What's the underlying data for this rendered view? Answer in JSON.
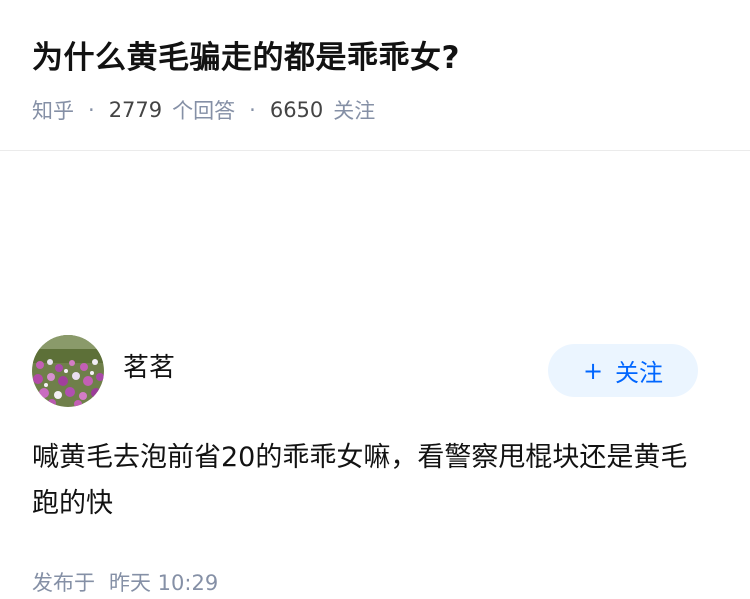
{
  "question": {
    "title": "为什么黄毛骗走的都是乖乖女?",
    "meta": {
      "source": "知乎",
      "answers_count": "2779",
      "answers_label": "个回答",
      "followers_count": "6650",
      "followers_label": "关注"
    }
  },
  "answer": {
    "author": "茗茗",
    "follow_button": {
      "icon": "+",
      "label": "关注"
    },
    "content": "喊黄毛去泡前省20的乖乖女嘛，看警察甩棍块还是黄毛跑的快",
    "published_label": "发布于",
    "published_time": "昨天 10:29"
  },
  "colors": {
    "accent": "#0066ff",
    "follow_bg": "#ebf5ff",
    "meta_gray": "#8590a6",
    "text": "#121212"
  }
}
